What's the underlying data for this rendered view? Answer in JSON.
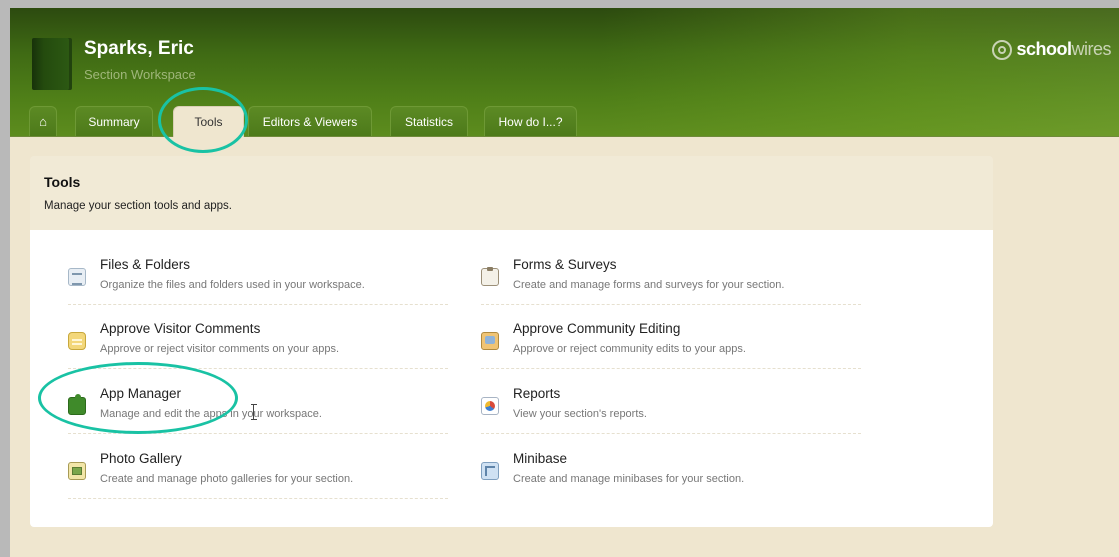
{
  "header": {
    "title": "Sparks, Eric",
    "subtitle": "Section Workspace",
    "brand_bold": "school",
    "brand_light": "wires"
  },
  "tabs": [
    {
      "label": "",
      "icon": "home-icon"
    },
    {
      "label": "Summary"
    },
    {
      "label": "Tools",
      "active": true
    },
    {
      "label": "Editors & Viewers"
    },
    {
      "label": "Statistics"
    },
    {
      "label": "How do I...?"
    }
  ],
  "section": {
    "title": "Tools",
    "description": "Manage your section tools and apps."
  },
  "tools": [
    {
      "name": "Files & Folders",
      "description": "Organize the files and folders used in your workspace.",
      "icon": "document-icon"
    },
    {
      "name": "Forms & Surveys",
      "description": "Create and manage forms and surveys for your section.",
      "icon": "clipboard-icon"
    },
    {
      "name": "Approve Visitor Comments",
      "description": "Approve or reject visitor comments on your apps.",
      "icon": "comment-icon"
    },
    {
      "name": "Approve Community Editing",
      "description": "Approve or reject community edits to your apps.",
      "icon": "community-edit-icon"
    },
    {
      "name": "App Manager",
      "description": "Manage and edit the apps in your workspace.",
      "icon": "puzzle-icon"
    },
    {
      "name": "Reports",
      "description": "View your section's reports.",
      "icon": "pie-chart-icon"
    },
    {
      "name": "Photo Gallery",
      "description": "Create and manage photo galleries for your section.",
      "icon": "photo-gallery-icon"
    },
    {
      "name": "Minibase",
      "description": "Create and manage minibases for your section.",
      "icon": "minibase-icon"
    }
  ],
  "colors": {
    "header_green": "#3f6a14",
    "annotation": "#19c2a4",
    "background": "#efe6cf"
  }
}
